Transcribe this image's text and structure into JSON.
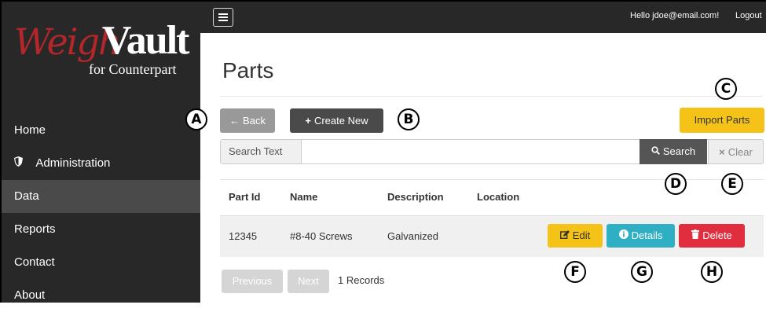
{
  "logo": {
    "part1": "Weigh",
    "part2": "Vault",
    "tagline": "for Counterpart"
  },
  "sidebar": {
    "items": [
      {
        "label": "Home",
        "icon": ""
      },
      {
        "label": "Administration",
        "icon": "shield-icon"
      },
      {
        "label": "Data",
        "icon": "",
        "active": true
      },
      {
        "label": "Reports",
        "icon": ""
      },
      {
        "label": "Contact",
        "icon": ""
      },
      {
        "label": "About",
        "icon": ""
      }
    ]
  },
  "topbar": {
    "greeting": "Hello jdoe@email.com!",
    "logout": "Logout"
  },
  "page": {
    "title": "Parts"
  },
  "toolbar": {
    "back": "Back",
    "create": "Create New",
    "import": "Import Parts"
  },
  "search": {
    "label": "Search Text",
    "value": "",
    "search_button": "Search",
    "clear_button": "Clear"
  },
  "table": {
    "headers": [
      "Part Id",
      "Name",
      "Description",
      "Location"
    ],
    "rows": [
      {
        "part_id": "12345",
        "name": "#8-40 Screws",
        "description": "Galvanized",
        "location": ""
      }
    ],
    "actions": {
      "edit": "Edit",
      "details": "Details",
      "delete": "Delete"
    }
  },
  "pagination": {
    "previous": "Previous",
    "next": "Next",
    "records": "1 Records"
  },
  "callouts": [
    "A",
    "B",
    "C",
    "D",
    "E",
    "F",
    "G",
    "H"
  ],
  "colors": {
    "sidebar": "#282828",
    "active_nav": "#4a4a4a",
    "warning": "#f5c218",
    "info": "#2eafc4",
    "danger": "#e02e3e"
  }
}
